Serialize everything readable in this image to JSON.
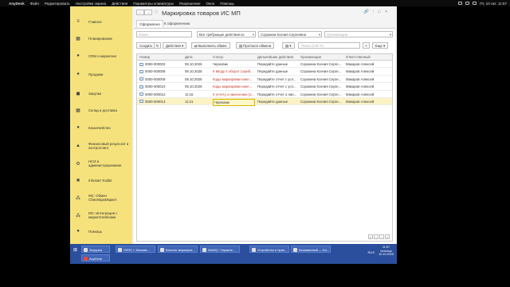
{
  "mac": {
    "apple": "",
    "app": "AnyDesk",
    "menus": [
      "Файл",
      "Редактировать",
      "Настройки экрана",
      "Действия",
      "Параметры клавиатуры",
      "Разрешение",
      "Окно",
      "Помощь"
    ],
    "clock": "Пт, 10 окт. 11:57"
  },
  "sidebar": {
    "items": [
      {
        "label": "Главное",
        "icon": "menu-icon",
        "glyph": "≡"
      },
      {
        "label": "Планирование",
        "icon": "calendar-icon",
        "glyph": "▦"
      },
      {
        "label": "CRM и маркетинг",
        "icon": "crm-icon",
        "glyph": "●"
      },
      {
        "label": "Продажи",
        "icon": "sales-icon",
        "glyph": "●"
      },
      {
        "label": "Закупки",
        "icon": "purchase-icon",
        "glyph": "◼"
      },
      {
        "label": "Склад и доставка",
        "icon": "warehouse-icon",
        "glyph": "▦"
      },
      {
        "label": "Казначейство",
        "icon": "treasury-icon",
        "glyph": "●"
      },
      {
        "label": "Финансовый результат и контроллинг",
        "icon": "finance-icon",
        "glyph": "▲"
      },
      {
        "label": "НСИ и администрирование",
        "icon": "settings-icon",
        "glyph": "⚙"
      },
      {
        "label": "Infostart Toolkit",
        "icon": "tools-icon",
        "glyph": "✖"
      },
      {
        "label": "МС: Обмен СбисМаркМаркет",
        "icon": "exchange-icon",
        "glyph": "⁂"
      },
      {
        "label": "МС: Интеграция с маркетплейсами",
        "icon": "integration-icon",
        "glyph": "⁂"
      },
      {
        "label": "Помощь",
        "icon": "help-icon",
        "glyph": "●"
      }
    ]
  },
  "header": {
    "back": "←",
    "forward": "→",
    "title": "Маркировка товаров ИС МП",
    "link_icon": "🔗",
    "more_icon": "⋮",
    "maximize_icon": "□",
    "close_icon": "×"
  },
  "tabs": [
    "Оформлено",
    "К оформлению"
  ],
  "filters": {
    "search_placeholder": "Поиск",
    "requires_action": "Все требующие действия ис",
    "responsible": "Сорокина Ксения Сергеевна",
    "org_placeholder": "Организация"
  },
  "toolbar": {
    "create": "Создать",
    "actions": "Действия",
    "exchange": "Выполнить обмен",
    "protocol": "Протокол обмена",
    "search": "Поиск (Ctrl+F)",
    "more": "Еще"
  },
  "columns": [
    "Номер",
    "Дата",
    "Статус",
    "Дальнейшие действия",
    "Организация",
    "Ответственный"
  ],
  "rows": [
    {
      "num": "0000-000003",
      "date": "08.10.2025",
      "status": "Черновик",
      "red": false,
      "next": "Передайте данные",
      "org": "Сорокина Ксения Серге...",
      "resp": "Макаров Алексей",
      "sel": false
    },
    {
      "num": "0000-000008",
      "date": "09.10.2025",
      "status": "К вводу в оборот (ошиб...",
      "red": true,
      "next": "Передайте данные",
      "org": "Сорокина Ксения Серге...",
      "resp": "Макаров Алексей",
      "sel": false
    },
    {
      "num": "0000-000009",
      "date": "09.10.2025",
      "status": "Коды маркировки нане...",
      "red": true,
      "next": "Передайте отчет с усл...",
      "org": "Сорокина Ксения Серге...",
      "resp": "Макаров Алексей",
      "sel": false
    },
    {
      "num": "0000-000010",
      "date": "09.10.2025",
      "status": "Коды маркировки нане...",
      "red": true,
      "next": "Передайте отчет с усл...",
      "org": "Сорокина Ксения Серге...",
      "resp": "Макаров Алексей",
      "sel": false
    },
    {
      "num": "0000-000012",
      "date": "11:16",
      "status": "К отчету о нанесению (о...",
      "red": true,
      "next": "Передайте отчет о нан...",
      "org": "Сорокина Ксения Серге...",
      "resp": "Макаров Алексей",
      "sel": false
    },
    {
      "num": "0000-000013",
      "date": "11:21",
      "status": "Черновик",
      "red": false,
      "next": "Передайте данные",
      "org": "Сорокина Ксения Серге...",
      "resp": "Макаров Алексей",
      "sel": true
    }
  ],
  "pager": [
    "«",
    "‹",
    "›",
    "»"
  ],
  "taskbar": {
    "start": "⊞",
    "row1": [
      "Загрузка",
      "УФПС г. Москвы ...",
      "Каталог маркиров...",
      "NAMQ / Управле...",
      "Устройство и прин...",
      "Безымянный — Бл..."
    ],
    "row2": [
      "AnyDesk"
    ],
    "lang": "RUS",
    "time": "11:57",
    "day": "пятница",
    "date": "10.10.2025"
  },
  "colors": {
    "sidebar": "#f6e27c",
    "selected_row": "#fbf2c6",
    "taskbar": "#2b4f9c",
    "status_red": "#c0392b"
  }
}
